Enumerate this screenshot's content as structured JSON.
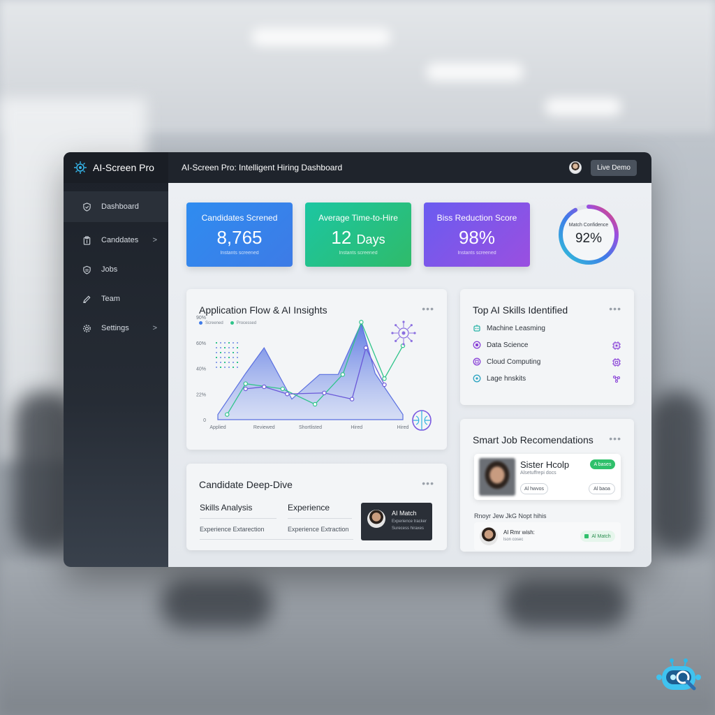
{
  "brand": {
    "name": "AI-Screen Pro"
  },
  "topbar": {
    "title": "AI-Screen Pro: Intelligent Hiring Dashboard",
    "live_demo": "Live Demo"
  },
  "sidebar": {
    "items": [
      {
        "label": "Dashboard",
        "icon": "shield-check-icon",
        "active": true
      },
      {
        "label": "Canddates",
        "icon": "clipboard-icon",
        "chevron": true
      },
      {
        "label": "Jobs",
        "icon": "briefcase-icon"
      },
      {
        "label": "Team",
        "icon": "pen-icon"
      },
      {
        "label": "Settings",
        "icon": "gear-icon",
        "chevron": true
      }
    ],
    "chevron": ">"
  },
  "stats": [
    {
      "label": "Candidates Screned",
      "value": "8,765",
      "sub": "Instants screened",
      "color": "#2f8cf0"
    },
    {
      "label": "Average Time-to-Hire",
      "value": "12",
      "unit": "Days",
      "sub": "Instants screened",
      "color": "#1cc6a2"
    },
    {
      "label": "Biss Reduction Score",
      "value": "98%",
      "sub": "Instants screened",
      "color": "#7a55ea"
    }
  ],
  "gauge": {
    "label": "Match Confidence",
    "value": "92%",
    "fraction": 0.92
  },
  "flow": {
    "title": "Application Flow & AI Insights",
    "dots": "•••",
    "legend": [
      "Screened",
      "Processed"
    ]
  },
  "chart_data": {
    "type": "area",
    "title": "Application Flow & AI Insights",
    "categories": [
      "Applied",
      "Reviewed",
      "Shortlisted",
      "Hired",
      "Hired"
    ],
    "y_ticks": [
      "0",
      "22%",
      "40%",
      "60%",
      "90%"
    ],
    "ylim": [
      0,
      100
    ],
    "legend_position": "top-left",
    "series": [
      {
        "name": "Screened",
        "color": "#5a6fe0",
        "points": [
          [
            0,
            5
          ],
          [
            0.6,
            45
          ],
          [
            1.0,
            70
          ],
          [
            1.6,
            20
          ],
          [
            2.2,
            44
          ],
          [
            2.6,
            44
          ],
          [
            3.1,
            94
          ],
          [
            3.4,
            45
          ],
          [
            4.0,
            5
          ]
        ]
      },
      {
        "name": "Processed",
        "color": "#2fc48a",
        "points": [
          [
            0.2,
            5
          ],
          [
            0.6,
            35
          ],
          [
            1.4,
            30
          ],
          [
            2.1,
            15
          ],
          [
            2.7,
            44
          ],
          [
            3.1,
            95
          ],
          [
            3.6,
            40
          ],
          [
            4.0,
            72
          ]
        ]
      },
      {
        "color": "#6a58d8",
        "points": [
          [
            0.6,
            30
          ],
          [
            1.0,
            32
          ],
          [
            1.5,
            25
          ],
          [
            2.3,
            26
          ],
          [
            2.9,
            20
          ],
          [
            3.2,
            70
          ],
          [
            3.6,
            34
          ]
        ]
      }
    ],
    "grid": false
  },
  "skills": {
    "title": "Top AI Skills Identified",
    "dots": "•••",
    "items": [
      {
        "label": "Machine Leasming",
        "icon": "robot-icon",
        "color": "#27b3a7"
      },
      {
        "label": "Data Science",
        "icon": "chip-icon",
        "color": "#8b45d8"
      },
      {
        "label": "Cloud Computing",
        "icon": "chip-icon",
        "color": "#8b45d8"
      },
      {
        "label": "Lage hnskits",
        "icon": "cog-icon",
        "color": "#2fa5c2"
      }
    ]
  },
  "deep": {
    "title": "Candidate Deep-Dive",
    "dots": "•••",
    "col1": "Skills Analysis",
    "col2": "Experience",
    "sub1": "Experience Extarection",
    "sub2": "Experience Extraction",
    "match_title": "AI Match",
    "match_sub1": "Experience tracker",
    "match_sub2": "Surecess hiraxes"
  },
  "jobs": {
    "title": "Smart Job Recomendations",
    "dots": "•••",
    "name": "Sister Hcolp",
    "sub": "Alsetuffrepi docs",
    "pill_top": "A bases",
    "pill_left": "Al hwvos",
    "pill_right": "Al baoa",
    "rec_label": "Rnoyr Jew JkG Nopt hihis",
    "rec_title": "Al Rmr wish:",
    "rec_sub": "lson cosec",
    "rec_pill": "Al Match"
  },
  "colors": {
    "accent": "#2f8cf0",
    "green": "#2fc06b",
    "purple": "#8b45d8",
    "dark": "#1f242c"
  }
}
